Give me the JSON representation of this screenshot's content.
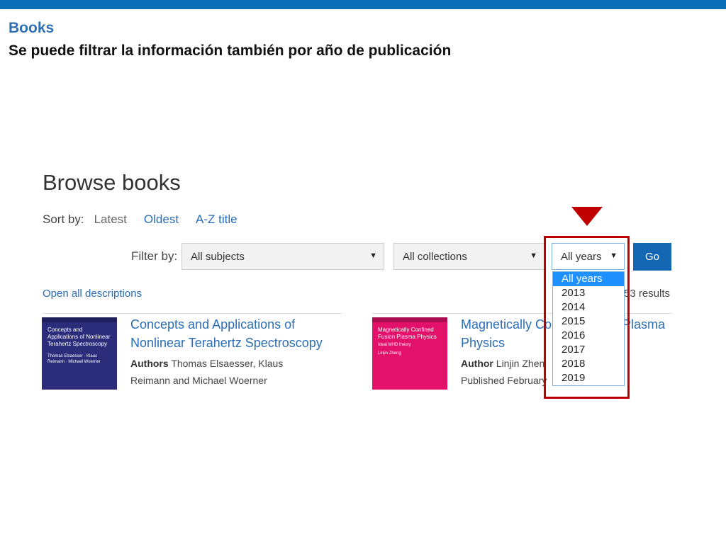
{
  "slide": {
    "title": "Books",
    "subtitle": "Se puede filtrar la información también por año de publicación"
  },
  "browse": {
    "title": "Browse books",
    "sort_label": "Sort by:",
    "sort_options": [
      "Latest",
      "Oldest",
      "A-Z title"
    ],
    "filter_label": "Filter by:",
    "subjects_select": "All subjects",
    "collections_select": "All collections",
    "years_select": "All years",
    "go_label": "Go",
    "open_all": "Open all descriptions",
    "results": "53 results"
  },
  "year_options": [
    "All years",
    "2013",
    "2014",
    "2015",
    "2016",
    "2017",
    "2018",
    "2019"
  ],
  "books": [
    {
      "title_line1": "Concepts and Applications of",
      "title_line2": "Nonlinear Terahertz Spectroscopy",
      "authors_label": "Authors",
      "authors_line1": "Thomas Elsaesser, Klaus",
      "authors_line2": "Reimann and Michael Woerner",
      "cover_title": "Concepts and Applications of Nonlinear Terahertz Spectroscopy",
      "cover_authors": "Thomas Elsaesser · Klaus Reimann · Michael Woerner",
      "cover_color": "#2b2d7b"
    },
    {
      "title_line1": "Magnetically Con",
      "title_line2": "Physics",
      "title_tail": "Plasma",
      "authors_label": "Author",
      "authors_line1": "Linjin Zhen",
      "published": "Published February",
      "cover_title": "Magnetically Confined Fusion Plasma Physics",
      "cover_subtitle": "Ideal MHD theory",
      "cover_authors": "Linjin Zheng",
      "cover_color": "#e3116a"
    }
  ],
  "colors": {
    "accent": "#0b6fb8",
    "link": "#2a6db5",
    "button": "#1367b3",
    "highlight": "#c00000",
    "dropdown_selected": "#1e90ff"
  }
}
